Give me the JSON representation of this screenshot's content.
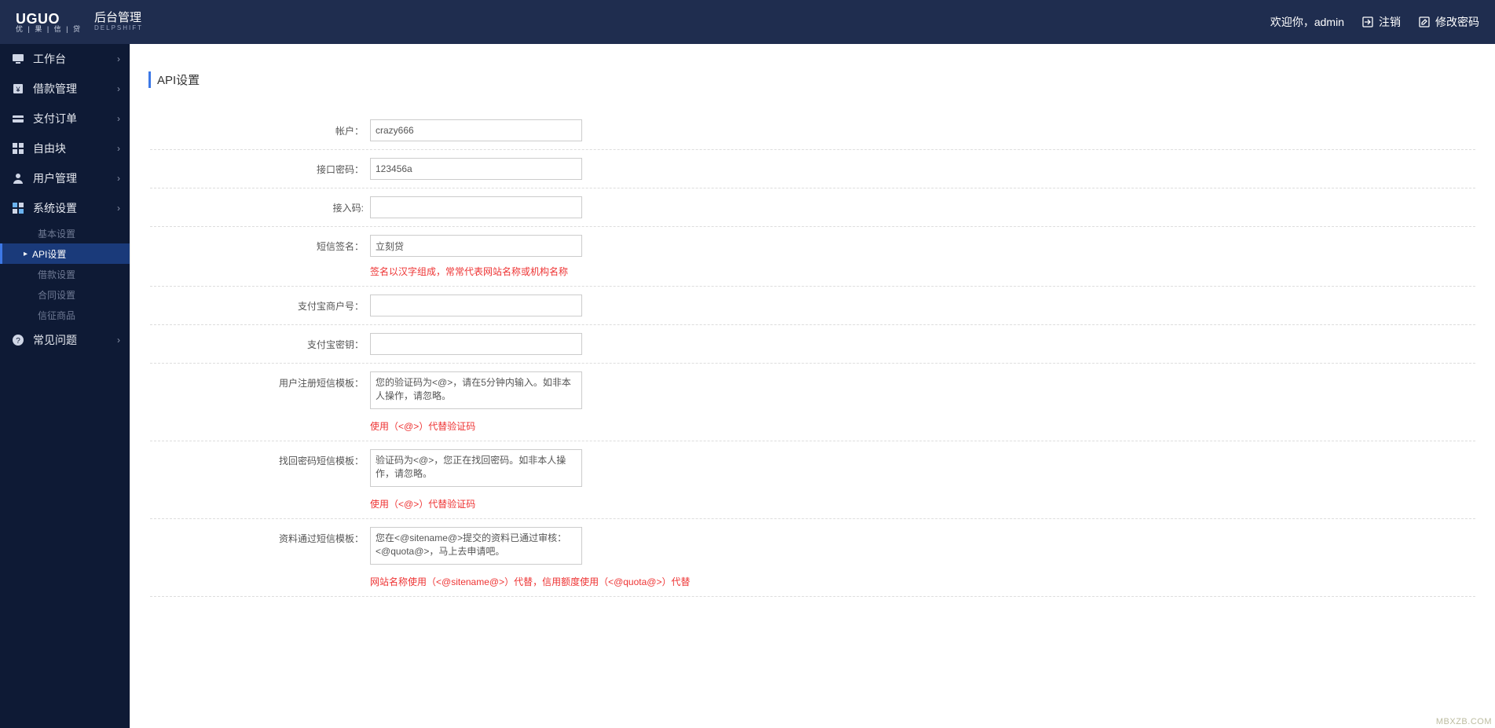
{
  "header": {
    "logo_top": "UGUO",
    "logo_bottom": "优 | 果 | 信 | 贷",
    "logo_side": "后台管理",
    "logo_side_sub": "DELPSHIFT",
    "welcome": "欢迎你，admin",
    "logout": "注销",
    "change_pwd": "修改密码"
  },
  "sidebar": {
    "items": [
      {
        "label": "工作台"
      },
      {
        "label": "借款管理"
      },
      {
        "label": "支付订单"
      },
      {
        "label": "自由块"
      },
      {
        "label": "用户管理"
      },
      {
        "label": "系统设置"
      },
      {
        "label": "常见问题"
      }
    ],
    "subitems": [
      {
        "label": "基本设置"
      },
      {
        "label": "API设置"
      },
      {
        "label": "借款设置"
      },
      {
        "label": "合同设置"
      },
      {
        "label": "信征商品"
      }
    ]
  },
  "page": {
    "title": "API设置"
  },
  "form": {
    "account": {
      "label": "帐户：",
      "value": "crazy666"
    },
    "api_password": {
      "label": "接口密码：",
      "value": "123456a"
    },
    "access_code": {
      "label": "接入码:",
      "value": ""
    },
    "sms_sign": {
      "label": "短信签名：",
      "value": "立刻贷",
      "hint": "签名以汉字组成，常常代表网站名称或机构名称"
    },
    "alipay_merchant": {
      "label": "支付宝商户号：",
      "value": ""
    },
    "alipay_secret": {
      "label": "支付宝密钥：",
      "value": ""
    },
    "register_tpl": {
      "label": "用户注册短信模板：",
      "value": "您的验证码为<@>，请在5分钟内输入。如非本人操作，请忽略。",
      "hint": "使用（<@>）代替验证码"
    },
    "findpwd_tpl": {
      "label": "找回密码短信模板：",
      "value": "验证码为<@>，您正在找回密码。如非本人操作，请忽略。",
      "hint": "使用（<@>）代替验证码"
    },
    "pass_tpl": {
      "label": "资料通过短信模板：",
      "value": "您在<@sitename@>提交的资料已通过审核：<@quota@>，马上去申请吧。",
      "hint": "网站名称使用（<@sitename@>）代替，信用额度使用（<@quota@>）代替"
    }
  },
  "watermark": "MBXZB.COM"
}
